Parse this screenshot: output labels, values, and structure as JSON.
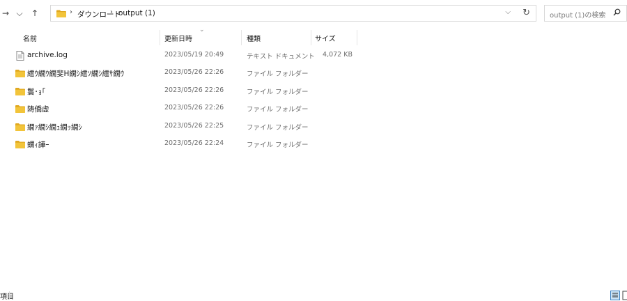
{
  "nav": {
    "back_icon": "arrow-right-icon",
    "recent_icon": "chevron-down-icon",
    "up_icon": "arrow-up-icon"
  },
  "address": {
    "breadcrumbs": [
      "ダウンロード",
      "output (1)"
    ],
    "separator": "›",
    "dropdown": "⌵",
    "refresh": "↻"
  },
  "search": {
    "placeholder": "output (1)の検索",
    "icon": "search-icon"
  },
  "columns": {
    "name": "名前",
    "modified": "更新日時",
    "type": "種類",
    "size": "サイズ"
  },
  "files": [
    {
      "name": "archive.log",
      "modified": "2023/05/19 20:49",
      "type": "テキスト ドキュメント",
      "size": "4,072 KB",
      "icon": "text-file-icon"
    },
    {
      "name": "繧ｳ繝ｳ繝斐Η繝ｼ繧ｿ繝ｼ繧ｻ繝ｳ",
      "modified": "2023/05/26 22:26",
      "type": "ファイル フォルダー",
      "size": "",
      "icon": "folder-icon"
    },
    {
      "name": "鬟･ｮ｢",
      "modified": "2023/05/26 22:26",
      "type": "ファイル フォルダー",
      "size": "",
      "icon": "folder-icon"
    },
    {
      "name": "陦僑虚",
      "modified": "2023/05/26 22:26",
      "type": "ファイル フォルダー",
      "size": "",
      "icon": "folder-icon"
    },
    {
      "name": "繝ｧ繝ｼ繝ｭ繝ｯ繝ｼ",
      "modified": "2023/05/26 22:25",
      "type": "ファイル フォルダー",
      "size": "",
      "icon": "folder-icon"
    },
    {
      "name": "蝟ｨ譁ｰ",
      "modified": "2023/05/26 22:24",
      "type": "ファイル フォルダー",
      "size": "",
      "icon": "folder-icon"
    }
  ],
  "status": {
    "count_text": "項目"
  },
  "colors": {
    "folder": "#f2c43a",
    "folder_dark": "#e0a820",
    "accent": "#3b82c4"
  }
}
